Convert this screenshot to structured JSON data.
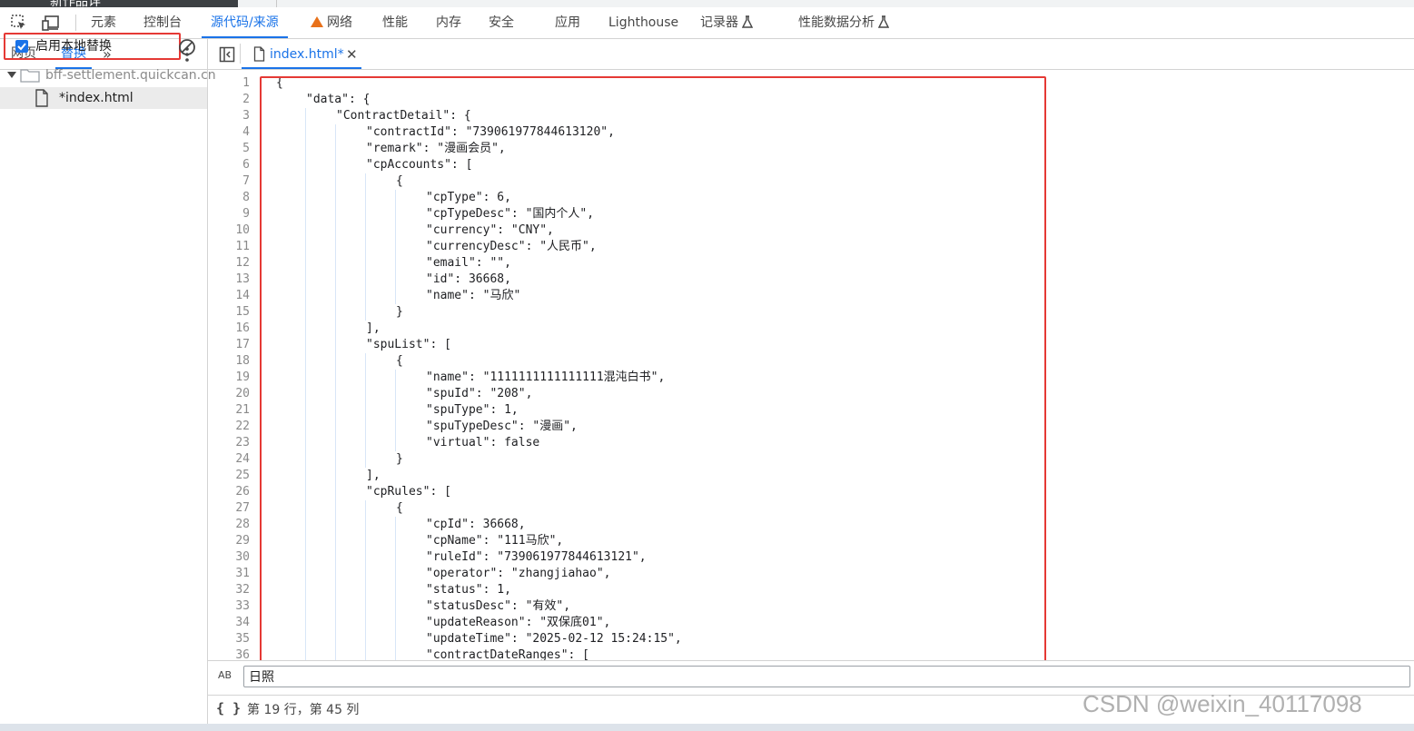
{
  "top_strip": {
    "title": "新作品详"
  },
  "main_tabs": [
    {
      "label": "元素"
    },
    {
      "label": "控制台"
    },
    {
      "label": "源代码/来源",
      "active": true
    },
    {
      "label": "网络",
      "warning": true
    },
    {
      "label": "性能"
    },
    {
      "label": "内存"
    },
    {
      "label": "安全"
    },
    {
      "label": "应用"
    },
    {
      "label": "Lighthouse"
    },
    {
      "label": "记录器",
      "icon": "flask-icon"
    },
    {
      "label": "性能数据分析",
      "icon": "flask-icon"
    }
  ],
  "left_panel": {
    "tabs": [
      {
        "label": "网页"
      },
      {
        "label": "替换",
        "active": true
      }
    ],
    "more_tabs": "»",
    "enable_overrides": {
      "label": "启用本地替换",
      "checked": true
    },
    "tree": {
      "folder": "bff-settlement.quickcan.cn",
      "file": "*index.html"
    }
  },
  "editor": {
    "open_file": "index.html*",
    "close_glyph": "✕",
    "lines": [
      {
        "n": "1",
        "text": "{",
        "indent": 0
      },
      {
        "n": "2",
        "text": "\"data\": {",
        "indent": 1
      },
      {
        "n": "3",
        "text": "\"ContractDetail\": {",
        "indent": 2
      },
      {
        "n": "4",
        "text": "\"contractId\": \"739061977844613120\",",
        "indent": 3
      },
      {
        "n": "5",
        "text": "\"remark\": \"漫画会员\",",
        "indent": 3
      },
      {
        "n": "6",
        "text": "\"cpAccounts\": [",
        "indent": 3
      },
      {
        "n": "7",
        "text": "{",
        "indent": 4
      },
      {
        "n": "8",
        "text": "\"cpType\": 6,",
        "indent": 5
      },
      {
        "n": "9",
        "text": "\"cpTypeDesc\": \"国内个人\",",
        "indent": 5
      },
      {
        "n": "10",
        "text": "\"currency\": \"CNY\",",
        "indent": 5
      },
      {
        "n": "11",
        "text": "\"currencyDesc\": \"人民币\",",
        "indent": 5
      },
      {
        "n": "12",
        "text": "\"email\": \"\",",
        "indent": 5
      },
      {
        "n": "13",
        "text": "\"id\": 36668,",
        "indent": 5
      },
      {
        "n": "14",
        "text": "\"name\": \"马欣\"",
        "indent": 5
      },
      {
        "n": "15",
        "text": "}",
        "indent": 4
      },
      {
        "n": "16",
        "text": "],",
        "indent": 3
      },
      {
        "n": "17",
        "text": "\"spuList\": [",
        "indent": 3
      },
      {
        "n": "18",
        "text": "{",
        "indent": 4
      },
      {
        "n": "19",
        "text": "\"name\": \"1111111111111111混沌白书\",",
        "indent": 5
      },
      {
        "n": "20",
        "text": "\"spuId\": \"208\",",
        "indent": 5
      },
      {
        "n": "21",
        "text": "\"spuType\": 1,",
        "indent": 5
      },
      {
        "n": "22",
        "text": "\"spuTypeDesc\": \"漫画\",",
        "indent": 5
      },
      {
        "n": "23",
        "text": "\"virtual\": false",
        "indent": 5
      },
      {
        "n": "24",
        "text": "}",
        "indent": 4
      },
      {
        "n": "25",
        "text": "],",
        "indent": 3
      },
      {
        "n": "26",
        "text": "\"cpRules\": [",
        "indent": 3
      },
      {
        "n": "27",
        "text": "{",
        "indent": 4
      },
      {
        "n": "28",
        "text": "\"cpId\": 36668,",
        "indent": 5
      },
      {
        "n": "29",
        "text": "\"cpName\": \"111马欣\",",
        "indent": 5
      },
      {
        "n": "30",
        "text": "\"ruleId\": \"739061977844613121\",",
        "indent": 5
      },
      {
        "n": "31",
        "text": "\"operator\": \"zhangjiahao\",",
        "indent": 5
      },
      {
        "n": "32",
        "text": "\"status\": 1,",
        "indent": 5
      },
      {
        "n": "33",
        "text": "\"statusDesc\": \"有效\",",
        "indent": 5
      },
      {
        "n": "34",
        "text": "\"updateReason\": \"双保底01\",",
        "indent": 5
      },
      {
        "n": "35",
        "text": "\"updateTime\": \"2025-02-12 15:24:15\",",
        "indent": 5
      },
      {
        "n": "36",
        "text": "\"contractDateRanges\": [",
        "indent": 5
      }
    ]
  },
  "search": {
    "icon_text": "AB",
    "value": "日照"
  },
  "status_bar": {
    "position": "第 19 行，第 45 列"
  },
  "watermark": "CSDN @weixin_40117098",
  "colors": {
    "accent": "#1a73e8",
    "highlight": "#e53935",
    "warning": "#e8711a"
  }
}
